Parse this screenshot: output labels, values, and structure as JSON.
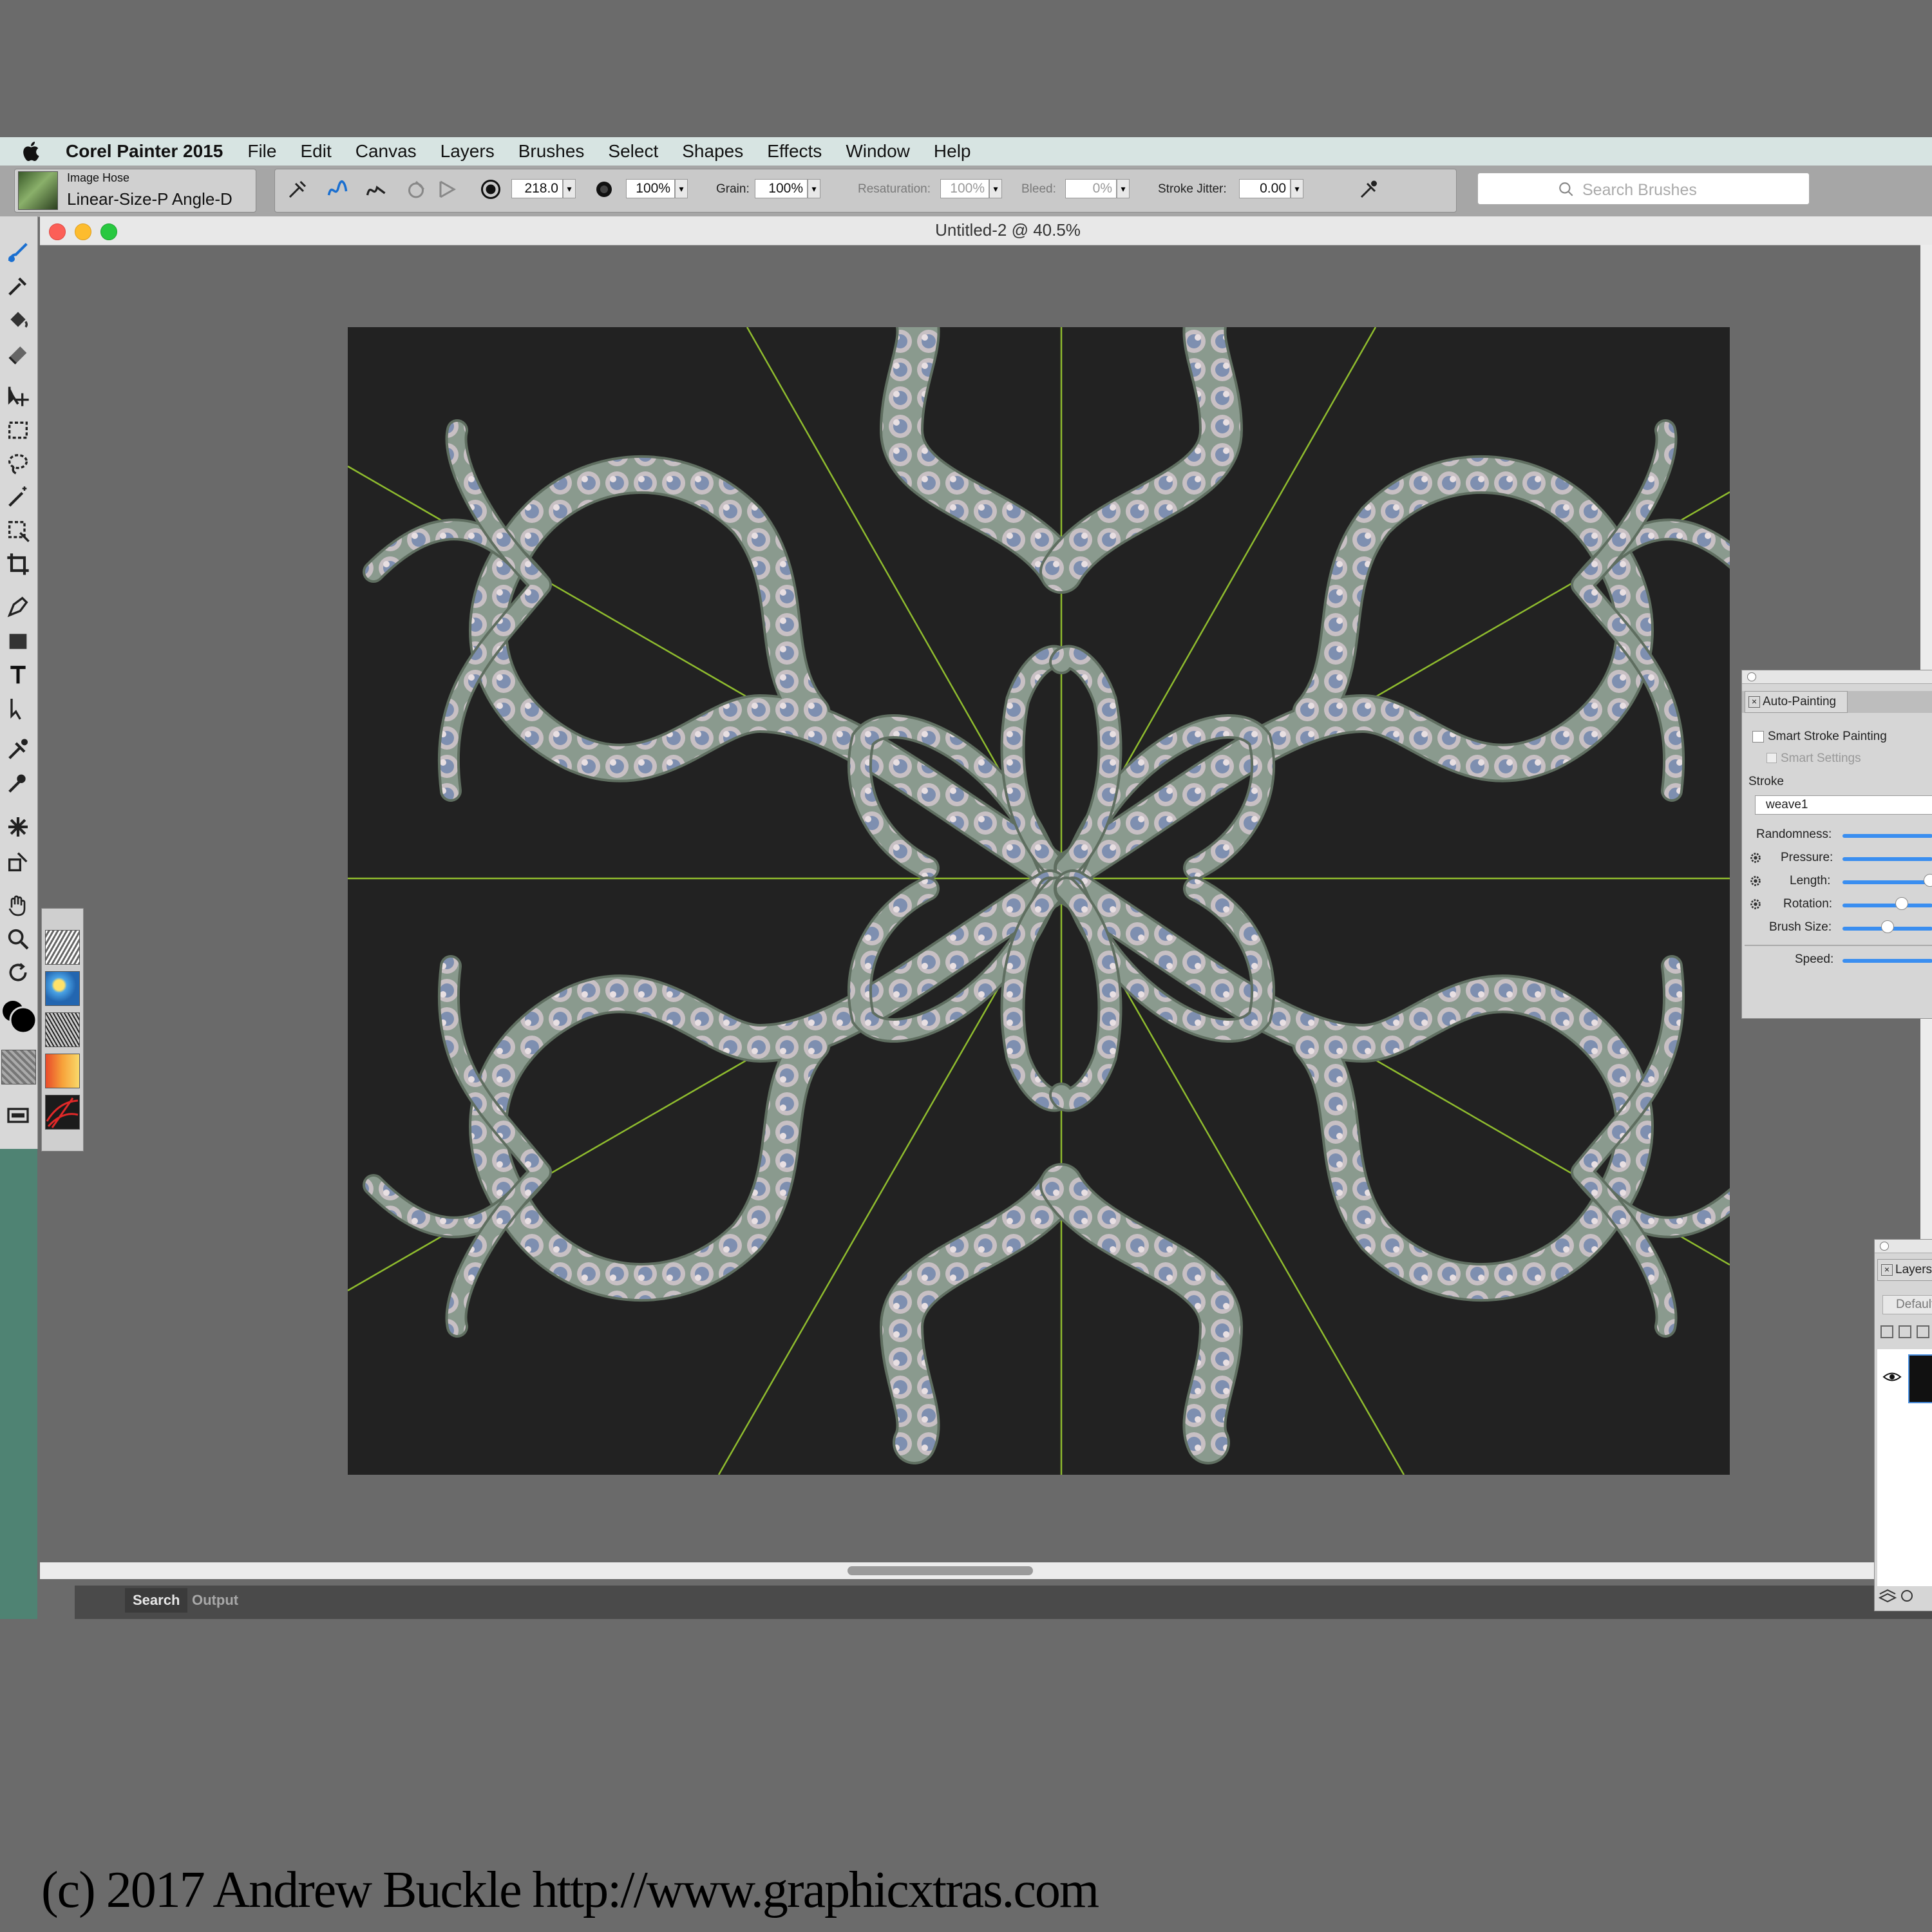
{
  "menubar": {
    "app_name": "Corel Painter 2015",
    "items": [
      "File",
      "Edit",
      "Canvas",
      "Layers",
      "Brushes",
      "Select",
      "Shapes",
      "Effects",
      "Window",
      "Help"
    ]
  },
  "brush": {
    "category": "Image Hose",
    "variant": "Linear-Size-P Angle-D"
  },
  "property_bar": {
    "size": "218.0",
    "opacity": "100%",
    "grain_label": "Grain:",
    "grain": "100%",
    "resaturation_label": "Resaturation:",
    "resaturation": "100%",
    "bleed_label": "Bleed:",
    "bleed": "0%",
    "jitter_label": "Stroke Jitter:",
    "jitter": "0.00"
  },
  "search": {
    "placeholder": "Search Brushes"
  },
  "document": {
    "title": "Untitled-2 @ 40.5%"
  },
  "bottom_tabs": {
    "search": "Search",
    "output": "Output"
  },
  "auto_painting": {
    "title": "Auto-Painting",
    "smart_stroke": "Smart Stroke Painting",
    "smart_settings": "Smart Settings",
    "stroke_label": "Stroke",
    "stroke_value": "weave1",
    "randomness": "Randomness:",
    "pressure": "Pressure:",
    "length": "Length:",
    "rotation": "Rotation:",
    "brush_size": "Brush Size:",
    "speed": "Speed:"
  },
  "layers_panel": {
    "title": "Layers",
    "composite": "Default"
  },
  "copyright": "(c) 2017 Andrew Buckle http://www.graphicxtras.com",
  "colors": {
    "guide": "#8fbc2e",
    "canvas": "#222222",
    "slider": "#3a8ef0"
  }
}
